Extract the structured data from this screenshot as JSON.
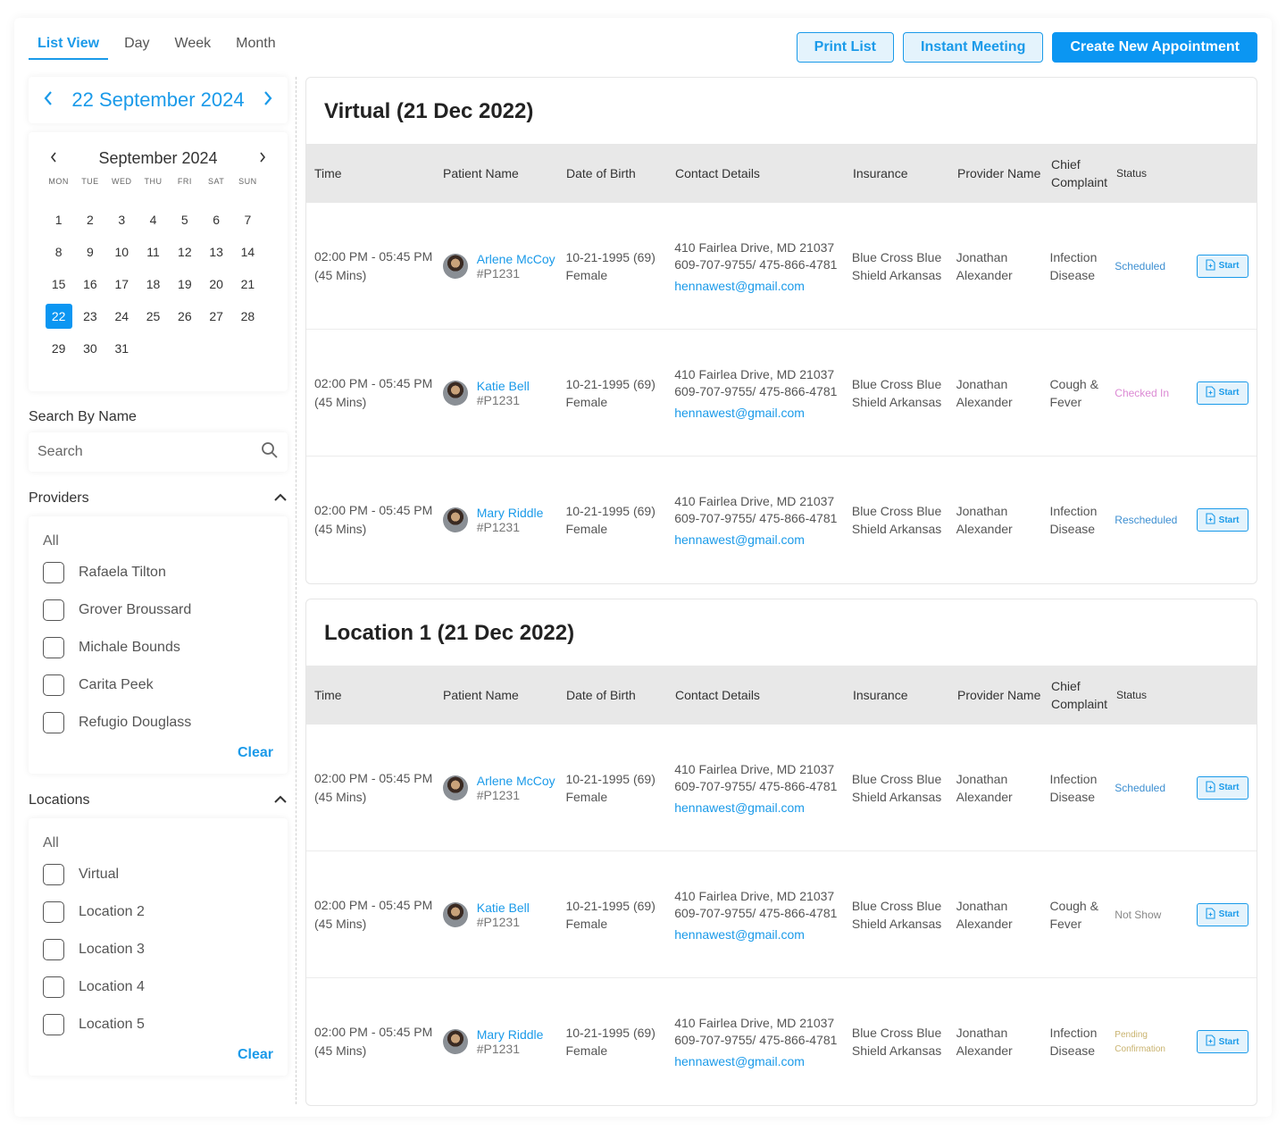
{
  "tabs": [
    "List View",
    "Day",
    "Week",
    "Month"
  ],
  "actions": {
    "print": "Print List",
    "instant": "Instant Meeting",
    "create": "Create New Appointment"
  },
  "date_nav": {
    "label": "22 September 2024"
  },
  "calendar": {
    "month": "September 2024",
    "weekdays": [
      "MON",
      "TUE",
      "WED",
      "THU",
      "FRI",
      "SAT",
      "SUN"
    ],
    "days": [
      "1",
      "2",
      "3",
      "4",
      "5",
      "6",
      "7",
      "8",
      "9",
      "10",
      "11",
      "12",
      "13",
      "14",
      "15",
      "16",
      "17",
      "18",
      "19",
      "20",
      "21",
      "22",
      "23",
      "24",
      "25",
      "26",
      "27",
      "28",
      "29",
      "30",
      "31"
    ],
    "selected": "22"
  },
  "search": {
    "title": "Search By Name",
    "placeholder": "Search"
  },
  "providers": {
    "title": "Providers",
    "all": "All",
    "items": [
      "Rafaela Tilton",
      "Grover Broussard",
      "Michale Bounds",
      "Carita Peek",
      "Refugio Douglass"
    ],
    "clear": "Clear"
  },
  "locations": {
    "title": "Locations",
    "all": "All",
    "items": [
      "Virtual",
      "Location 2",
      "Location 3",
      "Location 4",
      "Location 5"
    ],
    "clear": "Clear"
  },
  "columns": [
    "Time",
    "Patient Name",
    "Date of Birth",
    "Contact Details",
    "Insurance",
    "Provider Name",
    "Chief Complaint",
    "Status"
  ],
  "start_label": "Start",
  "groups": [
    {
      "title": "Virtual (21 Dec 2022)",
      "rows": [
        {
          "time": "02:00 PM - 05:45 PM",
          "duration": "(45 Mins)",
          "name": "Arlene McCoy",
          "pid": "#P1231",
          "dob": "10-21-1995 (69)",
          "gender": "Female",
          "address": "410 Fairlea Drive, MD 21037",
          "phone": "609-707-9755/ 475-866-4781",
          "email": "hennawest@gmail.com",
          "insurance": "Blue Cross Blue Shield Arkansas",
          "provider": "Jonathan Alexander",
          "complaint": "Infection Disease",
          "status": "Scheduled",
          "status_class": "st-scheduled"
        },
        {
          "time": "02:00 PM - 05:45 PM",
          "duration": "(45 Mins)",
          "name": "Katie Bell",
          "pid": "#P1231",
          "dob": "10-21-1995 (69)",
          "gender": "Female",
          "address": "410 Fairlea Drive, MD 21037",
          "phone": "609-707-9755/ 475-866-4781",
          "email": "hennawest@gmail.com",
          "insurance": "Blue Cross Blue Shield Arkansas",
          "provider": "Jonathan Alexander",
          "complaint": "Cough & Fever",
          "status": "Checked In",
          "status_class": "st-checked"
        },
        {
          "time": "02:00 PM - 05:45 PM",
          "duration": "(45 Mins)",
          "name": "Mary Riddle",
          "pid": "#P1231",
          "dob": "10-21-1995 (69)",
          "gender": "Female",
          "address": "410 Fairlea Drive, MD 21037",
          "phone": "609-707-9755/ 475-866-4781",
          "email": "hennawest@gmail.com",
          "insurance": "Blue Cross Blue Shield Arkansas",
          "provider": "Jonathan Alexander",
          "complaint": "Infection Disease",
          "status": "Rescheduled",
          "status_class": "st-resched"
        }
      ]
    },
    {
      "title": "Location 1 (21 Dec 2022)",
      "rows": [
        {
          "time": "02:00 PM - 05:45 PM",
          "duration": "(45 Mins)",
          "name": "Arlene McCoy",
          "pid": "#P1231",
          "dob": "10-21-1995 (69)",
          "gender": "Female",
          "address": "410 Fairlea Drive, MD 21037",
          "phone": "609-707-9755/ 475-866-4781",
          "email": "hennawest@gmail.com",
          "insurance": "Blue Cross Blue Shield Arkansas",
          "provider": "Jonathan Alexander",
          "complaint": "Infection Disease",
          "status": "Scheduled",
          "status_class": "st-scheduled"
        },
        {
          "time": "02:00 PM - 05:45 PM",
          "duration": "(45 Mins)",
          "name": "Katie Bell",
          "pid": "#P1231",
          "dob": "10-21-1995 (69)",
          "gender": "Female",
          "address": "410 Fairlea Drive, MD 21037",
          "phone": "609-707-9755/ 475-866-4781",
          "email": "hennawest@gmail.com",
          "insurance": "Blue Cross Blue Shield Arkansas",
          "provider": "Jonathan Alexander",
          "complaint": "Cough & Fever",
          "status": "Not Show",
          "status_class": "st-noshow"
        },
        {
          "time": "02:00 PM - 05:45 PM",
          "duration": "(45 Mins)",
          "name": "Mary Riddle",
          "pid": "#P1231",
          "dob": "10-21-1995 (69)",
          "gender": "Female",
          "address": "410 Fairlea Drive, MD 21037",
          "phone": "609-707-9755/ 475-866-4781",
          "email": "hennawest@gmail.com",
          "insurance": "Blue Cross Blue Shield Arkansas",
          "provider": "Jonathan Alexander",
          "complaint": "Infection Disease",
          "status": "Pending Confirmation",
          "status_class": "st-pending"
        }
      ]
    }
  ],
  "colors": {
    "accent": "#1a9ae9",
    "primary_button": "#0b96f2",
    "header_bg": "#e8e8e8"
  }
}
